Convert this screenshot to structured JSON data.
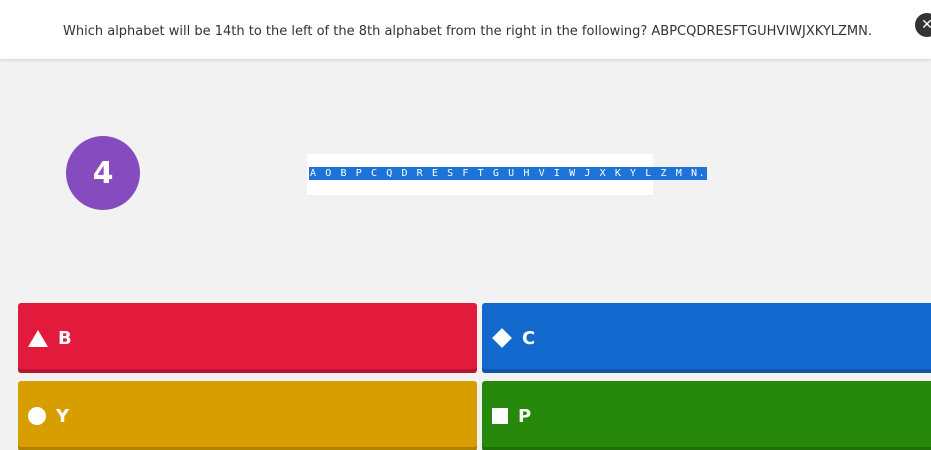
{
  "question": {
    "text": "Which alphabet will be 14th to the left of the 8th alphabet from the right in the following? ABPCQDRESFTGUHVIWJXKYLZMN.",
    "corner_icon": "close-icon"
  },
  "timer": {
    "value": "4",
    "color": "#864cbf"
  },
  "question_image": {
    "text": "A O B P C Q D R E S F T G U H V I W J X K Y L Z M N."
  },
  "answers": [
    {
      "shape": "triangle-icon",
      "label": "B",
      "color": "#e21b3c"
    },
    {
      "shape": "diamond-icon",
      "label": "C",
      "color": "#1368ce"
    },
    {
      "shape": "circle-icon",
      "label": "Y",
      "color": "#d89e00"
    },
    {
      "shape": "square-icon",
      "label": "P",
      "color": "#26890c"
    }
  ]
}
